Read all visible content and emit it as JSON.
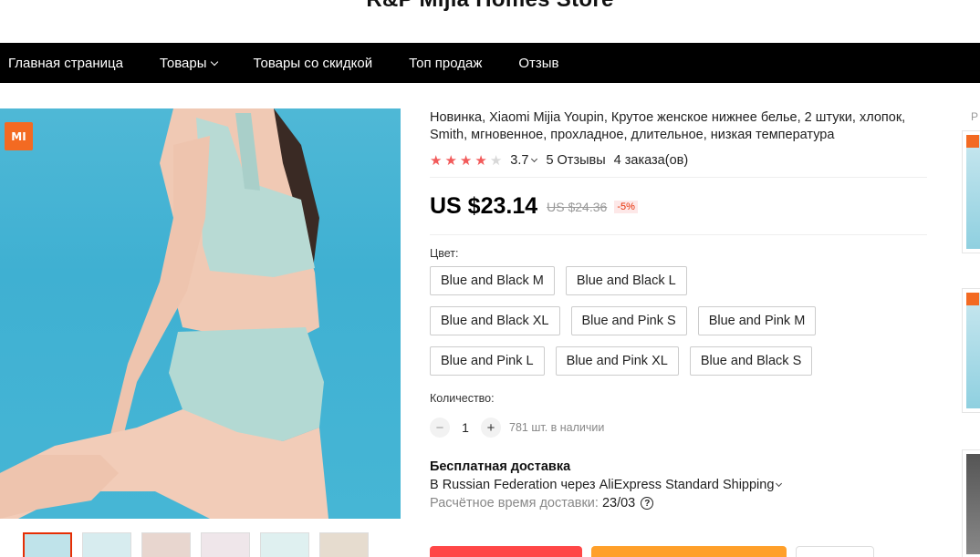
{
  "store": {
    "name": "R&P Mijia Homes Store"
  },
  "nav": {
    "items": [
      {
        "label": "Главная страница",
        "has_dropdown": false
      },
      {
        "label": "Товары",
        "has_dropdown": true
      },
      {
        "label": "Товары со скидкой",
        "has_dropdown": false
      },
      {
        "label": "Топ продаж",
        "has_dropdown": false
      },
      {
        "label": "Отзыв",
        "has_dropdown": false
      }
    ]
  },
  "gallery": {
    "logo_text": "MI",
    "thumbnail_count": 6,
    "active_index": 0
  },
  "product": {
    "title": "Новинка, Xiaomi Mijia Youpin, Крутое женское нижнее белье, 2 штуки, хлопок, Smith, мгновенное, прохладное, длительное, низкая температура",
    "rating": "3.7",
    "stars_filled": 4,
    "stars_total": 5,
    "reviews": "5 Отзывы",
    "orders": "4 заказа(ов)",
    "price": "US $23.14",
    "old_price": "US $24.36",
    "discount": "-5%"
  },
  "color": {
    "label": "Цвет:",
    "options": [
      "Blue and Black M",
      "Blue and Black L",
      "Blue and Black XL",
      "Blue and Pink S",
      "Blue and Pink M",
      "Blue and Pink L",
      "Blue and Pink XL",
      "Blue and Black S"
    ]
  },
  "quantity": {
    "label": "Количество:",
    "minus": "−",
    "plus": "+",
    "value": "1",
    "stock": "781 шт. в наличии"
  },
  "shipping": {
    "title": "Бесплатная доставка",
    "line": "В Russian Federation через AliExpress Standard Shipping",
    "eta_label": "Расчётное время доставки:",
    "eta_value": "23/03",
    "help": "?"
  },
  "rail": {
    "label": "Р"
  },
  "colors": {
    "nav_bg": "#000000",
    "price": "#000000",
    "discount": "#e62e04",
    "star": "#f25a5a",
    "buy_button": "#ff4747",
    "cart_button": "#ffa02a",
    "mi_logo": "#f36a22",
    "image_bg": "#46b6d5"
  }
}
